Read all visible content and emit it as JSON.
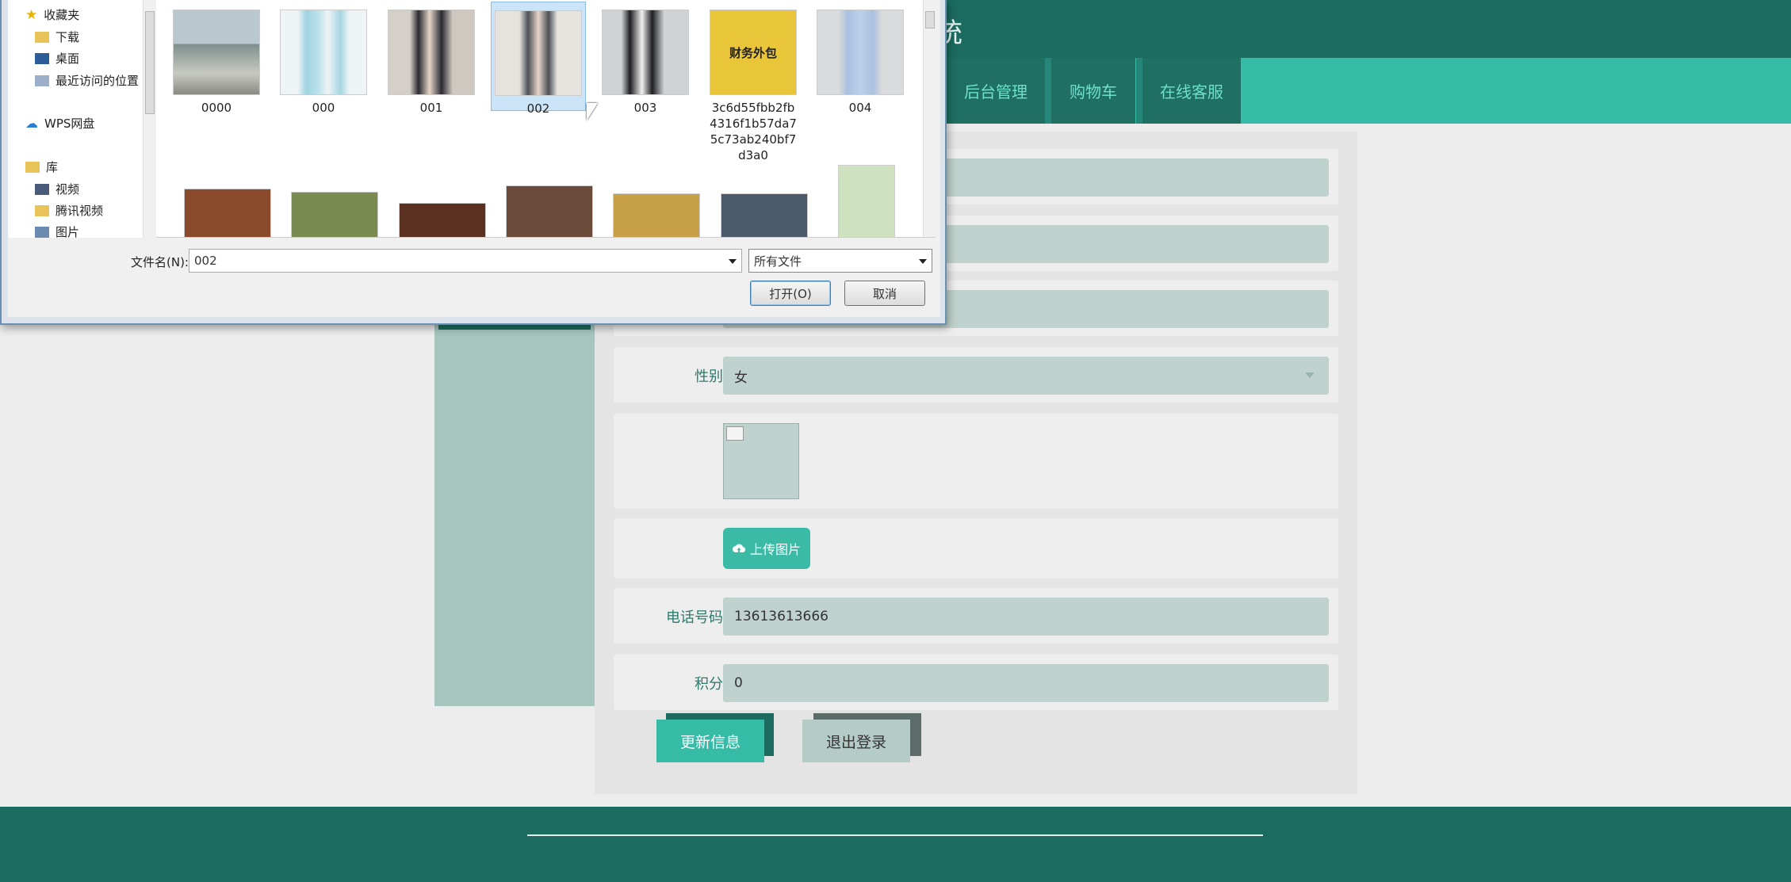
{
  "page": {
    "header_title_fragment": "统",
    "nav": [
      "后台管理",
      "购物车",
      "在线客服"
    ],
    "form": {
      "gender_label": "性别",
      "gender_value": "女",
      "upload_label": "上传图片",
      "phone_label": "电话号码",
      "phone_value": "13613613666",
      "points_label": "积分",
      "points_value": "0",
      "update_button": "更新信息",
      "logout_button": "退出登录"
    }
  },
  "dialog": {
    "nav_pane": {
      "favorites": "收藏夹",
      "downloads": "下载",
      "desktop": "桌面",
      "recent": "最近访问的位置",
      "wps": "WPS网盘",
      "library": "库",
      "videos": "视频",
      "tencent_video": "腾讯视频",
      "pictures": "图片"
    },
    "files": [
      "0000",
      "000",
      "001",
      "002",
      "003",
      "3c6d55fbb2fb4316f1b57da75c73ab240bf7d3a0",
      "004"
    ],
    "thumb_text": "财务外包",
    "selected_file": "002",
    "filename_label": "文件名(N):",
    "filename_value": "002",
    "filetype_value": "所有文件",
    "open_button": "打开(O)",
    "cancel_button": "取消"
  },
  "colors": {
    "header": "#1b6b5f",
    "navbar": "#35bba6",
    "accent": "#3bbba6",
    "input_bg": "#c0d2cd"
  }
}
